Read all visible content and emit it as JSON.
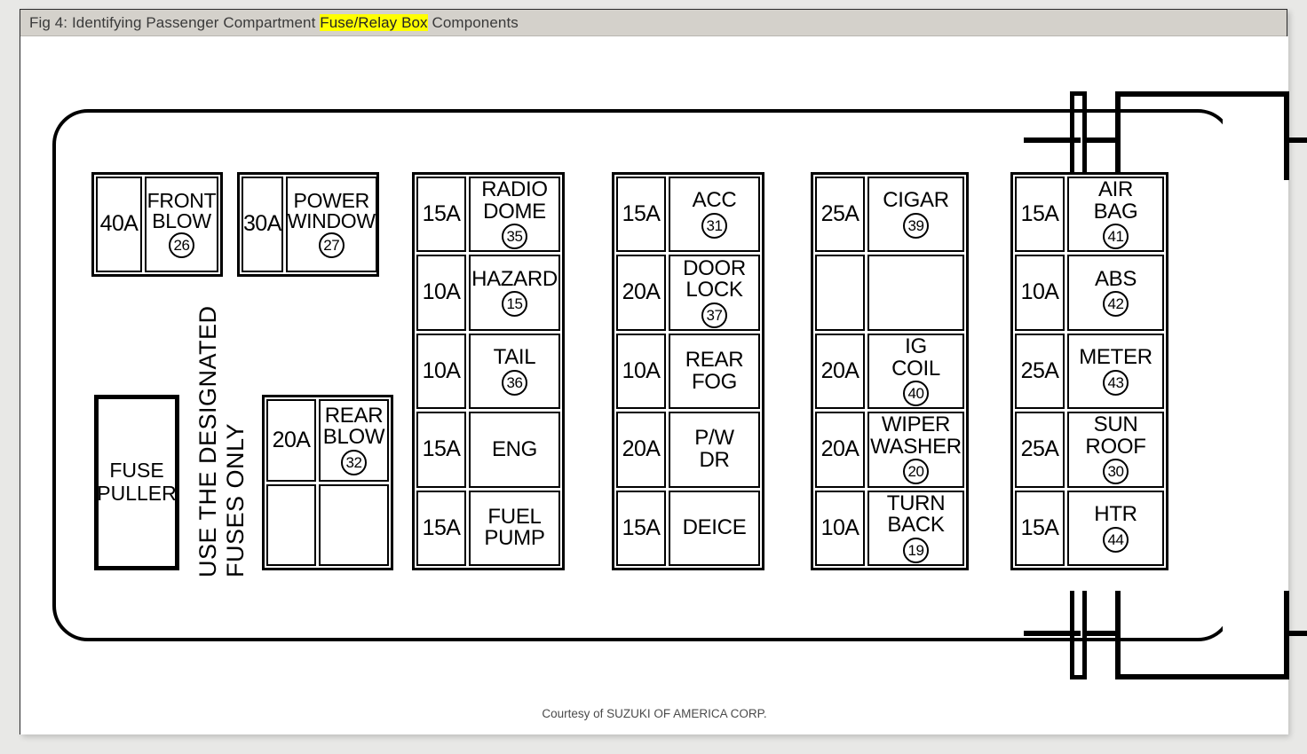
{
  "caption": {
    "prefix": "Fig 4: Identifying Passenger Compartment ",
    "highlight": "Fuse/Relay Box",
    "suffix": " Components"
  },
  "credit": "Courtesy of SUZUKI OF AMERICA CORP.",
  "notice": {
    "line1": "USE THE DESIGNATED",
    "line2": "FUSES ONLY"
  },
  "fuse_puller": {
    "line1": "FUSE",
    "line2": "PULLER"
  },
  "relays": [
    {
      "amp": "40A",
      "line1": "FRONT",
      "line2": "BLOW",
      "num": "26"
    },
    {
      "amp": "30A",
      "line1": "POWER",
      "line2": "WINDOW",
      "num": "27"
    }
  ],
  "rear_blow": {
    "amp": "20A",
    "line1": "REAR",
    "line2": "BLOW",
    "num": "32"
  },
  "columns": [
    {
      "id": "column-1",
      "rows": [
        {
          "amp": "15A",
          "line1": "RADIO",
          "line2": "DOME",
          "num": "35"
        },
        {
          "amp": "10A",
          "line1": "HAZARD",
          "line2": "",
          "num": "15"
        },
        {
          "amp": "10A",
          "line1": "TAIL",
          "line2": "",
          "num": "36"
        },
        {
          "amp": "15A",
          "line1": "ENG",
          "line2": "",
          "num": ""
        },
        {
          "amp": "15A",
          "line1": "FUEL",
          "line2": "PUMP",
          "num": ""
        }
      ]
    },
    {
      "id": "column-2",
      "rows": [
        {
          "amp": "15A",
          "line1": "ACC",
          "line2": "",
          "num": "31"
        },
        {
          "amp": "20A",
          "line1": "DOOR",
          "line2": "LOCK",
          "num": "37"
        },
        {
          "amp": "10A",
          "line1": "REAR",
          "line2": "FOG",
          "num": ""
        },
        {
          "amp": "20A",
          "line1": "P/W",
          "line2": "DR",
          "num": ""
        },
        {
          "amp": "15A",
          "line1": "DEICE",
          "line2": "",
          "num": ""
        }
      ]
    },
    {
      "id": "column-3",
      "rows": [
        {
          "amp": "25A",
          "line1": "CIGAR",
          "line2": "",
          "num": "39"
        },
        {
          "amp": "",
          "line1": "",
          "line2": "",
          "num": "",
          "empty": true
        },
        {
          "amp": "20A",
          "line1": "IG",
          "line2": "COIL",
          "num": "40"
        },
        {
          "amp": "20A",
          "line1": "WIPER",
          "line2": "WASHER",
          "num": "20"
        },
        {
          "amp": "10A",
          "line1": "TURN",
          "line2": "BACK",
          "num": "19"
        }
      ]
    },
    {
      "id": "column-4",
      "rows": [
        {
          "amp": "15A",
          "line1": "AIR",
          "line2": "BAG",
          "num": "41"
        },
        {
          "amp": "10A",
          "line1": "ABS",
          "line2": "",
          "num": "42"
        },
        {
          "amp": "25A",
          "line1": "METER",
          "line2": "",
          "num": "43"
        },
        {
          "amp": "25A",
          "line1": "SUN",
          "line2": "ROOF",
          "num": "30"
        },
        {
          "amp": "15A",
          "line1": "HTR",
          "line2": "",
          "num": "44"
        }
      ]
    }
  ],
  "colors": {
    "highlight": "#ffff00",
    "header_bar": "#d4d1cb",
    "line": "#000000",
    "page_background": "#e8e8e6"
  }
}
